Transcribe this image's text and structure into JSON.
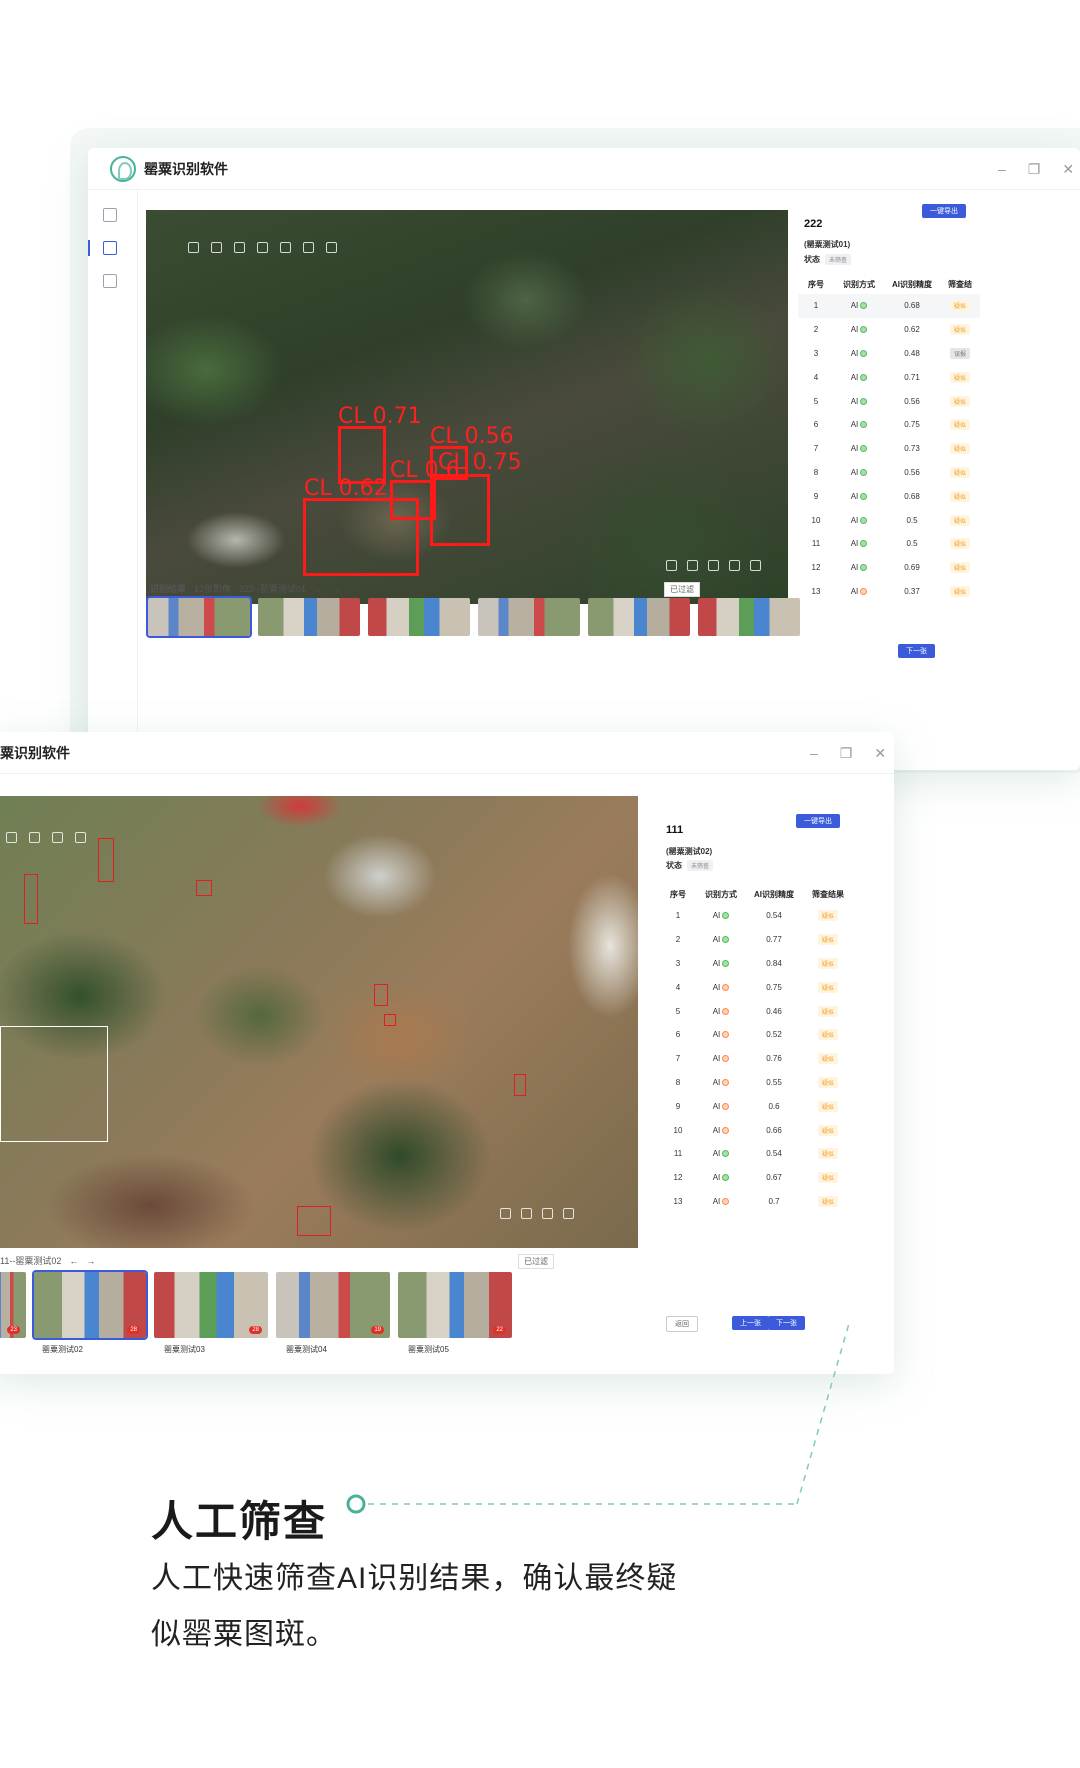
{
  "app": {
    "title": "罂粟识别软件",
    "title_truncated": "粟识别软件"
  },
  "window1": {
    "detections": [
      "CL 0.71",
      "CL 0.56",
      "CL 0.75",
      "CL 0.6",
      "CL 0.62"
    ],
    "result_bar": {
      "label": "识别结果",
      "count": "12张影像",
      "path": "222--罂粟测试01",
      "filter": "已过滤"
    },
    "panel": {
      "id": "222",
      "name": "(罂粟测试01)",
      "status_label": "状态",
      "status_value": "未筛查",
      "export_button": "一键导出",
      "headers": [
        "序号",
        "识别方式",
        "AI识别精度",
        "筛查结"
      ],
      "rows": [
        {
          "no": "1",
          "method": "AI",
          "score": "0.68",
          "result": "疑似",
          "icon": "green"
        },
        {
          "no": "2",
          "method": "AI",
          "score": "0.62",
          "result": "疑似",
          "icon": "green"
        },
        {
          "no": "3",
          "method": "AI",
          "score": "0.48",
          "result": "误报",
          "icon": "green"
        },
        {
          "no": "4",
          "method": "AI",
          "score": "0.71",
          "result": "疑似",
          "icon": "green"
        },
        {
          "no": "5",
          "method": "AI",
          "score": "0.56",
          "result": "疑似",
          "icon": "green"
        },
        {
          "no": "6",
          "method": "AI",
          "score": "0.75",
          "result": "疑似",
          "icon": "green"
        },
        {
          "no": "7",
          "method": "AI",
          "score": "0.73",
          "result": "疑似",
          "icon": "green"
        },
        {
          "no": "8",
          "method": "AI",
          "score": "0.56",
          "result": "疑似",
          "icon": "green"
        },
        {
          "no": "9",
          "method": "AI",
          "score": "0.68",
          "result": "疑似",
          "icon": "green"
        },
        {
          "no": "10",
          "method": "AI",
          "score": "0.5",
          "result": "疑似",
          "icon": "green"
        },
        {
          "no": "11",
          "method": "AI",
          "score": "0.5",
          "result": "疑似",
          "icon": "green"
        },
        {
          "no": "12",
          "method": "AI",
          "score": "0.69",
          "result": "疑似",
          "icon": "green"
        },
        {
          "no": "13",
          "method": "AI",
          "score": "0.37",
          "result": "疑似",
          "icon": "orange"
        }
      ],
      "next_button": "下一张"
    }
  },
  "window2": {
    "result_bar": {
      "path": "11--罂粟测试02",
      "filter": "已过滤"
    },
    "thumb_labels": [
      "罂粟测试02",
      "罂粟测试03",
      "罂粟测试04",
      "罂粟测试05"
    ],
    "thumb_badges": [
      "23",
      "28",
      "28",
      "19",
      "22"
    ],
    "panel": {
      "id": "111",
      "name": "(罂粟测试02)",
      "status_label": "状态",
      "status_value": "未筛查",
      "export_button": "一键导出",
      "headers": [
        "序号",
        "识别方式",
        "AI识别精度",
        "筛查结果"
      ],
      "rows": [
        {
          "no": "1",
          "method": "AI",
          "score": "0.54",
          "result": "疑似",
          "icon": "green"
        },
        {
          "no": "2",
          "method": "AI",
          "score": "0.77",
          "result": "疑似",
          "icon": "green"
        },
        {
          "no": "3",
          "method": "AI",
          "score": "0.84",
          "result": "疑似",
          "icon": "green"
        },
        {
          "no": "4",
          "method": "AI",
          "score": "0.75",
          "result": "疑似",
          "icon": "orange"
        },
        {
          "no": "5",
          "method": "AI",
          "score": "0.46",
          "result": "疑似",
          "icon": "orange"
        },
        {
          "no": "6",
          "method": "AI",
          "score": "0.52",
          "result": "疑似",
          "icon": "orange"
        },
        {
          "no": "7",
          "method": "AI",
          "score": "0.76",
          "result": "疑似",
          "icon": "orange"
        },
        {
          "no": "8",
          "method": "AI",
          "score": "0.55",
          "result": "疑似",
          "icon": "orange"
        },
        {
          "no": "9",
          "method": "AI",
          "score": "0.6",
          "result": "疑似",
          "icon": "orange"
        },
        {
          "no": "10",
          "method": "AI",
          "score": "0.66",
          "result": "疑似",
          "icon": "orange"
        },
        {
          "no": "11",
          "method": "AI",
          "score": "0.54",
          "result": "疑似",
          "icon": "green"
        },
        {
          "no": "12",
          "method": "AI",
          "score": "0.67",
          "result": "疑似",
          "icon": "green"
        },
        {
          "no": "13",
          "method": "AI",
          "score": "0.7",
          "result": "疑似",
          "icon": "orange"
        }
      ],
      "back_button": "返回",
      "prev_button": "上一张",
      "next_button": "下一张"
    }
  },
  "feature": {
    "heading": "人工筛查",
    "description": "人工快速筛查AI识别结果，确认最终疑似罂粟图斑。"
  },
  "colors": {
    "accent": "#3b5bdb",
    "brand_green": "#48b29b",
    "detection_red": "#ff1a1a",
    "warn_orange": "#f0a020"
  }
}
